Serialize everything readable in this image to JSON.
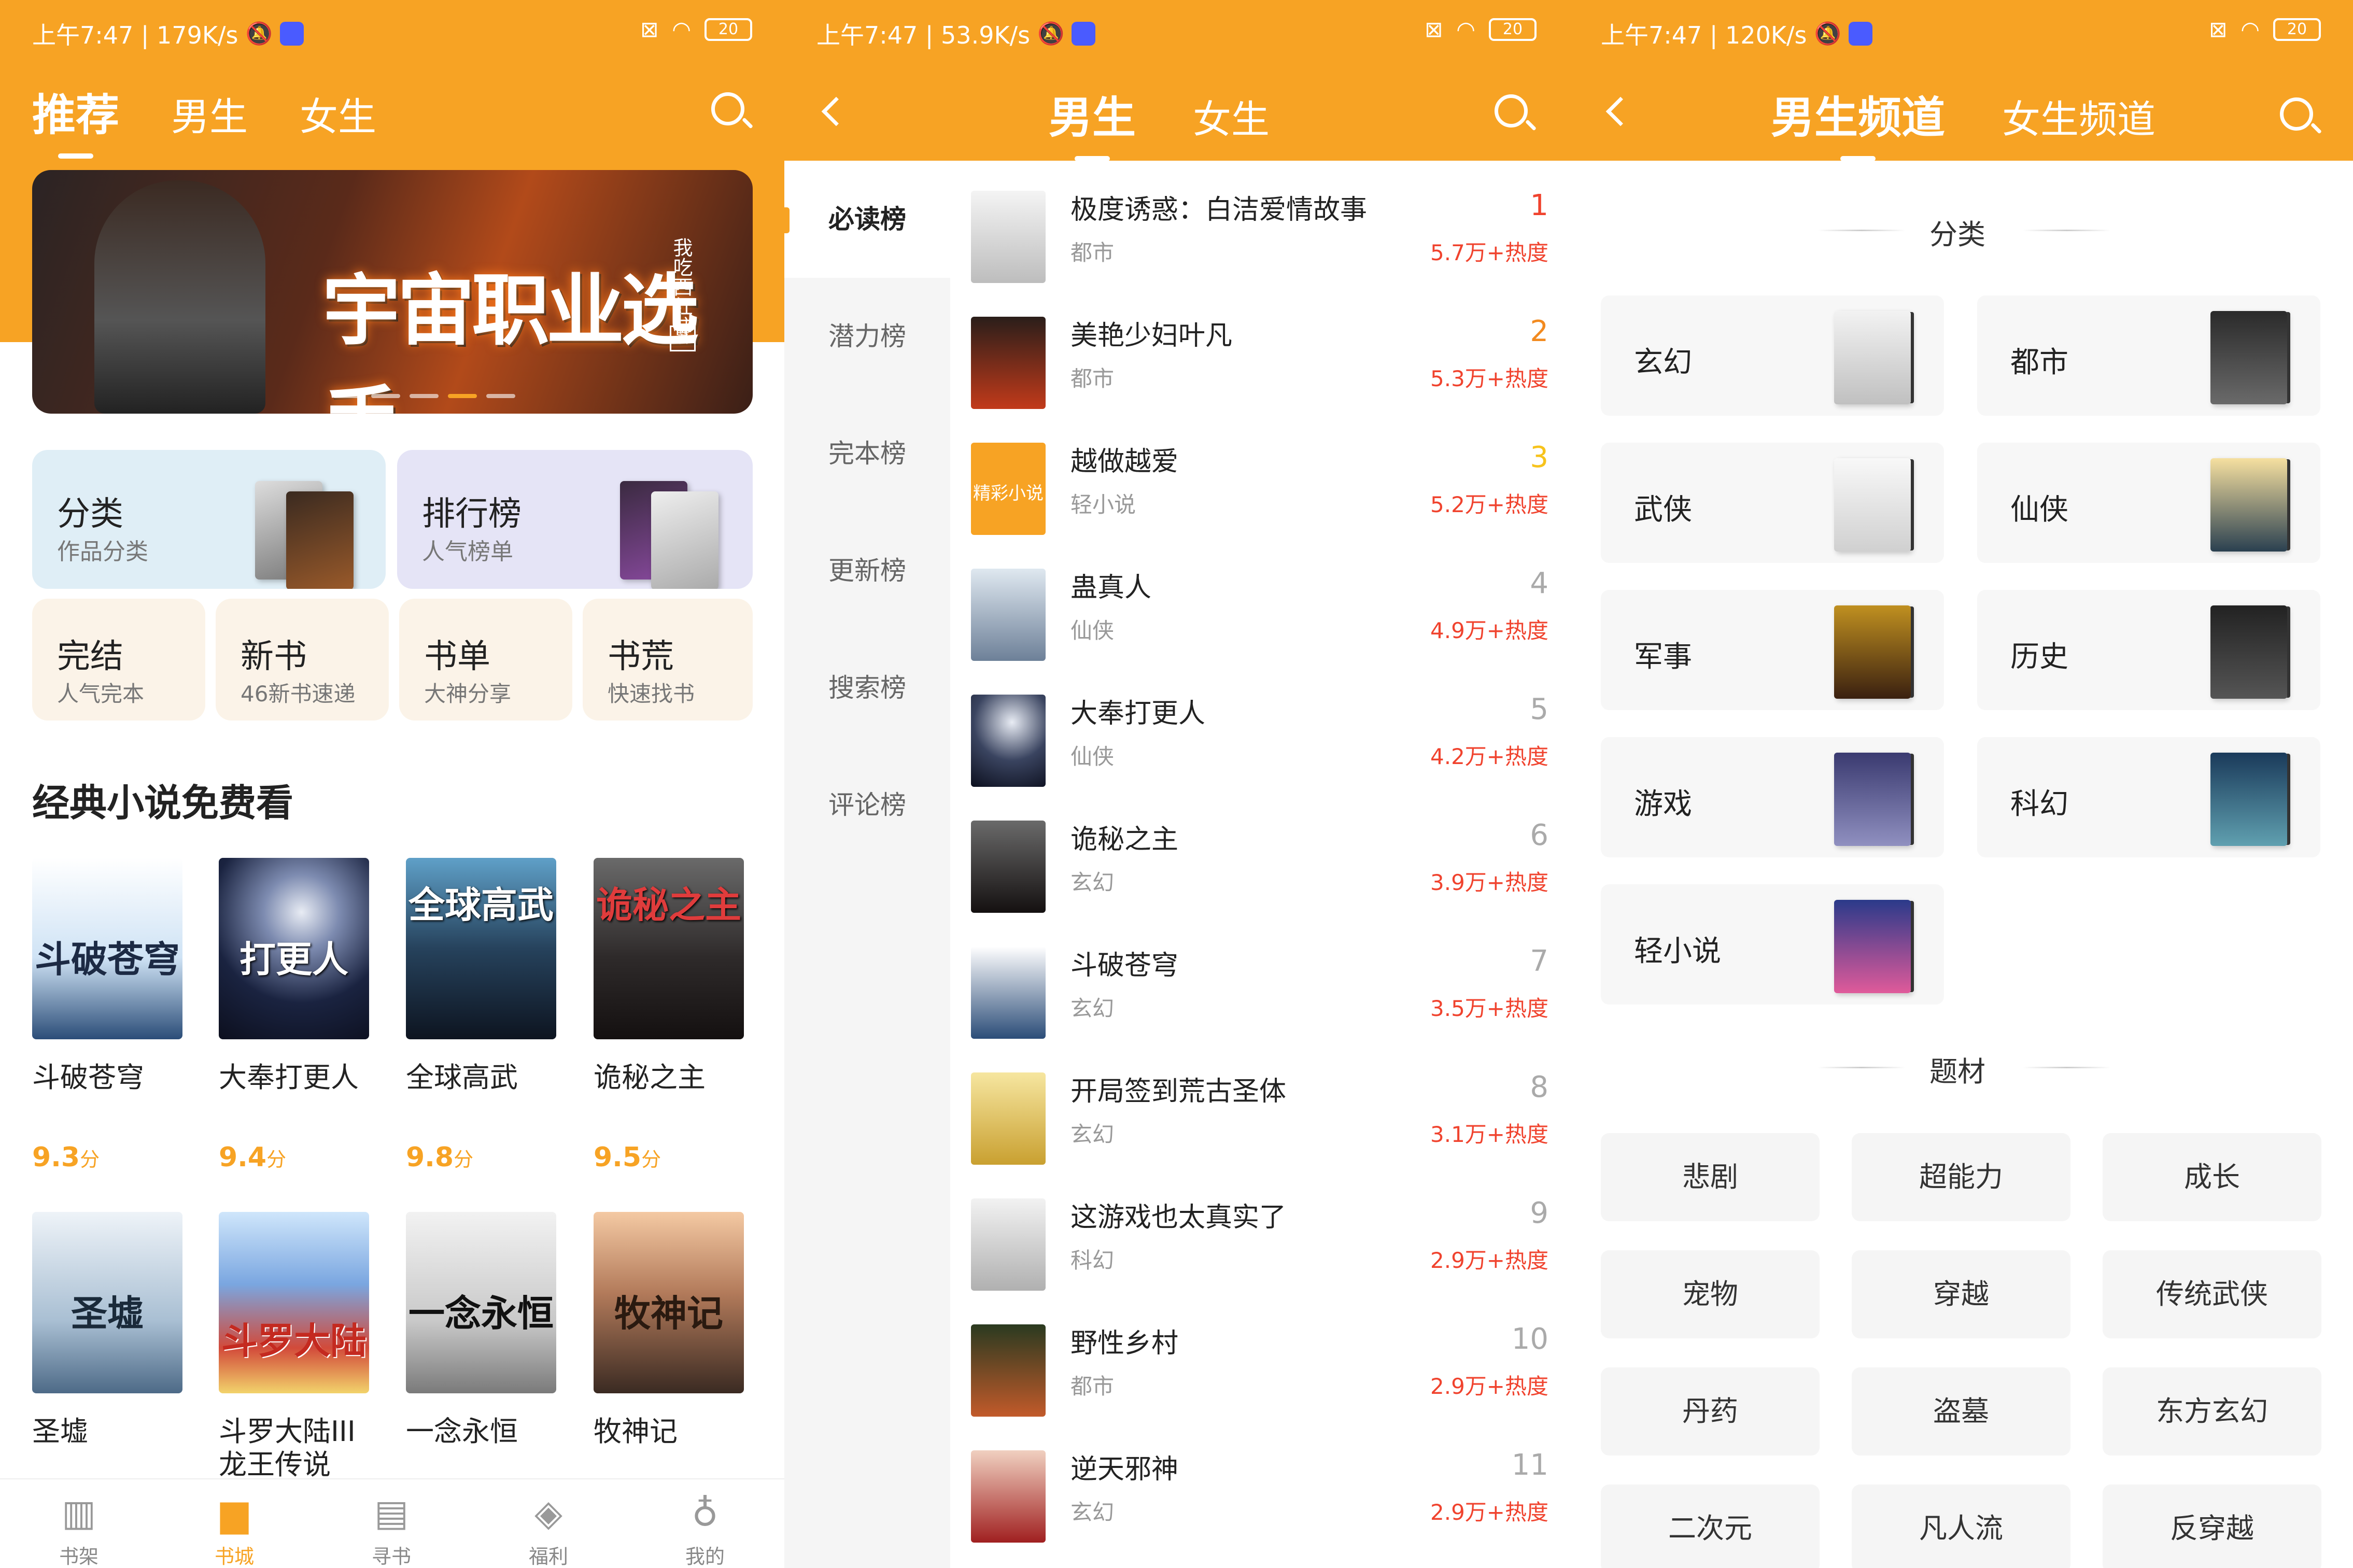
{
  "status_bars": [
    {
      "time": "上午7:47 | 179K/s",
      "battery": "20"
    },
    {
      "time": "上午7:47 | 53.9K/s",
      "battery": "20"
    },
    {
      "time": "上午7:47 | 120K/s",
      "battery": "20"
    }
  ],
  "panel1": {
    "tabs": [
      "推荐",
      "男生",
      "女生"
    ],
    "banner": {
      "title": "宇宙职业选手",
      "side_text": "我吃西红柿",
      "stamp": "著"
    },
    "quick_cards": [
      {
        "title": "分类",
        "subtitle": "作品分类"
      },
      {
        "title": "排行榜",
        "subtitle": "人气榜单"
      }
    ],
    "small_cards": [
      {
        "title": "完结",
        "subtitle": "人气完本"
      },
      {
        "title": "新书",
        "subtitle": "46新书速递"
      },
      {
        "title": "书单",
        "subtitle": "大神分享"
      },
      {
        "title": "书荒",
        "subtitle": "快速找书"
      }
    ],
    "section_title": "经典小说免费看",
    "books_row1": [
      {
        "name": "斗破苍穹",
        "score": "9.3",
        "unit": "分",
        "cover_text": "斗破苍穹"
      },
      {
        "name": "大奉打更人",
        "score": "9.4",
        "unit": "分",
        "cover_text": "打更人"
      },
      {
        "name": "全球高武",
        "score": "9.8",
        "unit": "分",
        "cover_text": "全球高武"
      },
      {
        "name": "诡秘之主",
        "score": "9.5",
        "unit": "分",
        "cover_text": "诡秘之主"
      }
    ],
    "books_row2": [
      {
        "name": "圣墟",
        "cover_text": "圣墟"
      },
      {
        "name": "斗罗大陆III龙王传说",
        "cover_text": "斗罗大陆"
      },
      {
        "name": "一念永恒",
        "cover_text": "一念永恒"
      },
      {
        "name": "牧神记",
        "cover_text": "牧神记"
      }
    ],
    "bottom_nav": [
      "书架",
      "书城",
      "寻书",
      "福利",
      "我的"
    ]
  },
  "panel2": {
    "tabs": [
      "男生",
      "女生"
    ],
    "sidebar": [
      "必读榜",
      "潜力榜",
      "完本榜",
      "更新榜",
      "搜索榜",
      "评论榜"
    ],
    "rank_list": [
      {
        "rank": "1",
        "title": "极度诱惑：白洁爱情故事",
        "category": "都市",
        "heat": "5.7万+热度"
      },
      {
        "rank": "2",
        "title": "美艳少妇叶凡",
        "category": "都市",
        "heat": "5.3万+热度"
      },
      {
        "rank": "3",
        "title": "越做越爱",
        "category": "轻小说",
        "heat": "5.2万+热度",
        "cover_text": "精彩小说"
      },
      {
        "rank": "4",
        "title": "蛊真人",
        "category": "仙侠",
        "heat": "4.9万+热度"
      },
      {
        "rank": "5",
        "title": "大奉打更人",
        "category": "仙侠",
        "heat": "4.2万+热度"
      },
      {
        "rank": "6",
        "title": "诡秘之主",
        "category": "玄幻",
        "heat": "3.9万+热度"
      },
      {
        "rank": "7",
        "title": "斗破苍穹",
        "category": "玄幻",
        "heat": "3.5万+热度"
      },
      {
        "rank": "8",
        "title": "开局签到荒古圣体",
        "category": "玄幻",
        "heat": "3.1万+热度"
      },
      {
        "rank": "9",
        "title": "这游戏也太真实了",
        "category": "科幻",
        "heat": "2.9万+热度"
      },
      {
        "rank": "10",
        "title": "野性乡村",
        "category": "都市",
        "heat": "2.9万+热度"
      },
      {
        "rank": "11",
        "title": "逆天邪神",
        "category": "玄幻",
        "heat": "2.9万+热度"
      }
    ]
  },
  "panel3": {
    "tabs": [
      "男生频道",
      "女生频道"
    ],
    "section_category": "分类",
    "categories": [
      "玄幻",
      "都市",
      "武侠",
      "仙侠",
      "军事",
      "历史",
      "游戏",
      "科幻",
      "轻小说"
    ],
    "section_theme": "题材",
    "themes": [
      "悲剧",
      "超能力",
      "成长",
      "宠物",
      "穿越",
      "传统武侠",
      "丹药",
      "盗墓",
      "东方玄幻",
      "二次元",
      "凡人流",
      "反穿越"
    ]
  },
  "colors": {
    "accent": "#f7a324",
    "rank_red": "#f0432e"
  }
}
